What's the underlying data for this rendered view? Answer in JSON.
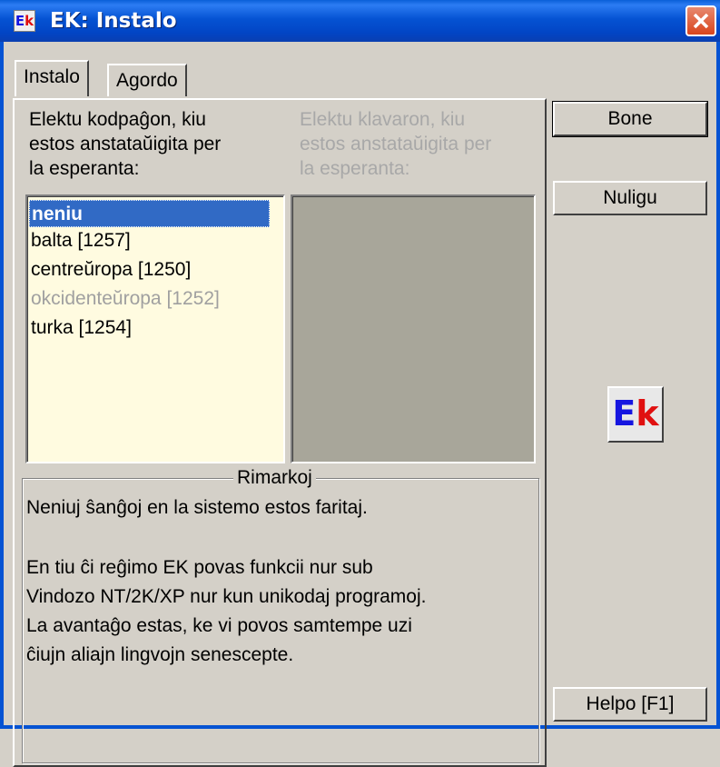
{
  "window": {
    "title": "EK: Instalo",
    "icon_text": "Ek"
  },
  "tabs": [
    {
      "label": "Instalo",
      "active": true
    },
    {
      "label": "Agordo",
      "active": false
    }
  ],
  "codepage": {
    "label_lines": [
      "Elektu kodpaĝon, kiu",
      "estos anstataŭigita per",
      "la esperanta:"
    ],
    "items": [
      {
        "label": "neniu",
        "state": "selected"
      },
      {
        "label": "balta [1257]",
        "state": "normal"
      },
      {
        "label": "centreŭropa [1250]",
        "state": "normal"
      },
      {
        "label": "okcidenteŭropa [1252]",
        "state": "disabled"
      },
      {
        "label": "turka [1254]",
        "state": "normal"
      }
    ]
  },
  "keyboard": {
    "label_lines": [
      "Elektu klavaron, kiu",
      "estos anstataŭigita per",
      "la esperanta:"
    ]
  },
  "remarks": {
    "legend": "Rimarkoj",
    "lines": [
      "Neniuj ŝanĝoj en la sistemo estos faritaj.",
      "",
      "En tiu ĉi reĝimo EK povas funkcii nur sub",
      "Vindozo NT/2K/XP nur kun unikodaj programoj.",
      "La avantaĝo estas, ke vi povos samtempe uzi",
      "ĉiujn aliajn lingvojn senescepte."
    ]
  },
  "buttons": {
    "ok_label": "Bone",
    "cancel_label": "Nuligu",
    "help_label": "Helpo [F1]"
  },
  "logo": {
    "e": "E",
    "k": "k"
  },
  "colors": {
    "titlebar": "#0553d3",
    "selection": "#316ac5",
    "list_background": "#fffbe0",
    "logo_e": "#1515e0",
    "logo_k": "#e01010"
  }
}
